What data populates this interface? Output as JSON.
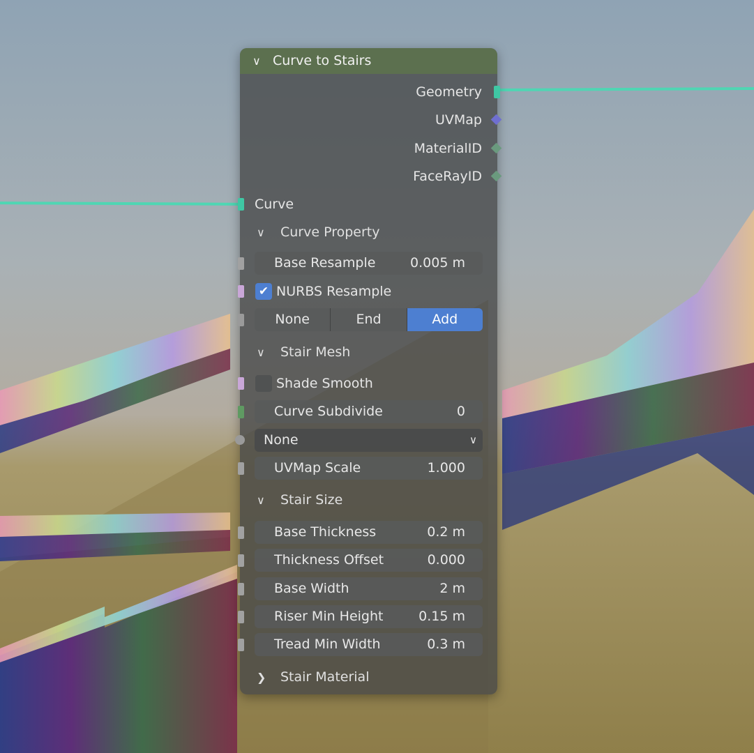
{
  "node": {
    "title": "Curve to Stairs",
    "outputs": [
      {
        "label": "Geometry",
        "icon": "square-socket-icon",
        "color": "#3fc7a4"
      },
      {
        "label": "UVMap",
        "icon": "diamond-socket-icon",
        "color": "#6f6fd0"
      },
      {
        "label": "MaterialID",
        "icon": "diamond-socket-icon",
        "color": "#6a9a7e"
      },
      {
        "label": "FaceRayID",
        "icon": "diamond-socket-icon",
        "color": "#6a9a7e"
      }
    ],
    "curve_input": {
      "label": "Curve",
      "color": "#3fc7a4"
    },
    "panels": {
      "curve_property": {
        "label": "Curve Property"
      },
      "stair_mesh": {
        "label": "Stair Mesh"
      },
      "stair_size": {
        "label": "Stair Size"
      },
      "stair_material": {
        "label": "Stair Material"
      }
    },
    "base_resample": {
      "label": "Base Resample",
      "value": "0.005 m"
    },
    "nurbs_resample": {
      "label": "NURBS Resample",
      "checked": true
    },
    "end_mode": {
      "options": [
        "None",
        "End",
        "Add"
      ],
      "selected": "Add"
    },
    "shade_smooth": {
      "label": "Shade Smooth",
      "checked": false
    },
    "curve_subdivide": {
      "label": "Curve Subdivide",
      "value": "0"
    },
    "uv_dropdown": {
      "selected": "None"
    },
    "uvmap_scale": {
      "label": "UVMap Scale",
      "value": "1.000"
    },
    "size_fields": [
      {
        "label": "Base Thickness",
        "value": "0.2 m"
      },
      {
        "label": "Thickness Offset",
        "value": "0.000"
      },
      {
        "label": "Base Width",
        "value": "2 m"
      },
      {
        "label": "Riser Min Height",
        "value": "0.15 m"
      },
      {
        "label": "Tread Min Width",
        "value": "0.3 m"
      }
    ]
  },
  "colors": {
    "accent": "#4d7fd1",
    "header": "#5c724e",
    "wire": "#4fd6b3",
    "float_socket": "#a1a1a1",
    "bool_socket": "#c9a7d8",
    "int_socket": "#5f9a62",
    "menu_socket": "#9a9a9a"
  }
}
